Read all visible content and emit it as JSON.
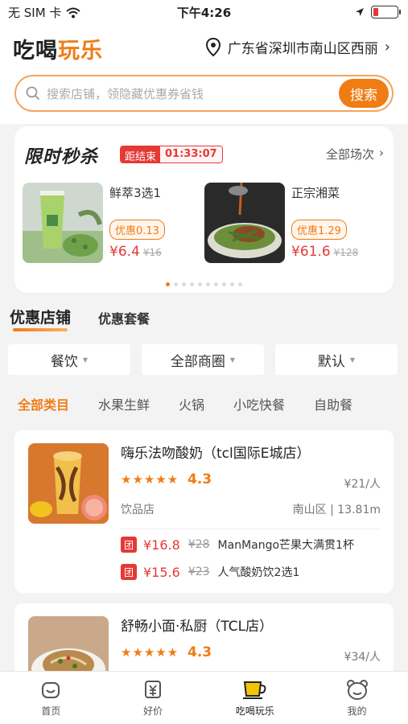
{
  "status": {
    "carrier": "无 SIM 卡",
    "time": "下午4:26"
  },
  "header": {
    "logo_part1": "吃喝",
    "logo_part2": "玩乐",
    "location": "广东省深圳市南山区西丽"
  },
  "search": {
    "placeholder": "搜索店铺，领隐藏优惠券省钱",
    "button": "搜索"
  },
  "flash_sale": {
    "title": "限时秒杀",
    "countdown_label": "距结束",
    "countdown_time": "01:33:07",
    "all_label": "全部场次",
    "products": [
      {
        "name": "鲜萃3选1",
        "coupon": "优惠0.13",
        "price": "¥6.4",
        "orig": "¥16"
      },
      {
        "name": "正宗湘菜",
        "coupon": "优惠1.29",
        "price": "¥61.6",
        "orig": "¥128"
      }
    ]
  },
  "section_tabs": {
    "active": "优惠店铺",
    "other": "优惠套餐"
  },
  "filters": [
    "餐饮",
    "全部商圈",
    "默认"
  ],
  "categories": [
    "全部类目",
    "水果生鲜",
    "火锅",
    "小吃快餐",
    "自助餐"
  ],
  "stores": [
    {
      "name": "嗨乐法吻酸奶（tcl国际E城店）",
      "stars": "★★★★★",
      "rating": "4.3",
      "per": "¥21/人",
      "type": "饮品店",
      "dist": "南山区 | 13.81m",
      "deals": [
        {
          "tag": "团",
          "price": "¥16.8",
          "orig": "¥28",
          "name": "ManMango芒果大满贯1杯"
        },
        {
          "tag": "团",
          "price": "¥15.6",
          "orig": "¥23",
          "name": "人气酸奶饮2选1"
        }
      ]
    },
    {
      "name": "舒畅小面·私厨（TCL店）",
      "stars": "★★★★★",
      "rating": "4.3",
      "per": "¥34/人"
    }
  ],
  "tabbar": [
    "首页",
    "好价",
    "吃喝玩乐",
    "我的"
  ],
  "colors": {
    "accent": "#f07c14",
    "price_red": "#e53935"
  }
}
